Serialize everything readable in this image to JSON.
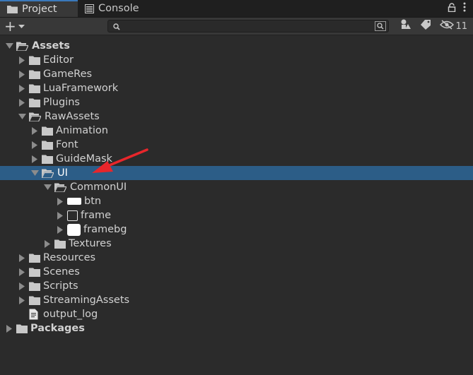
{
  "tabs": [
    {
      "label": "Project",
      "icon": "folder-icon",
      "active": true
    },
    {
      "label": "Console",
      "icon": "console-icon",
      "active": false
    }
  ],
  "toolbar": {
    "add_label": "+",
    "search_value": "",
    "hidden_count": "11"
  },
  "tree": [
    {
      "label": "Assets",
      "depth": 0,
      "expanded": true,
      "bold": true,
      "icon": "folder-open-icon"
    },
    {
      "label": "Editor",
      "depth": 1,
      "expanded": false,
      "icon": "folder-icon"
    },
    {
      "label": "GameRes",
      "depth": 1,
      "expanded": false,
      "icon": "folder-icon"
    },
    {
      "label": "LuaFramework",
      "depth": 1,
      "expanded": false,
      "icon": "folder-icon"
    },
    {
      "label": "Plugins",
      "depth": 1,
      "expanded": false,
      "icon": "folder-icon"
    },
    {
      "label": "RawAssets",
      "depth": 1,
      "expanded": true,
      "icon": "folder-open-icon"
    },
    {
      "label": "Animation",
      "depth": 2,
      "expanded": false,
      "icon": "folder-icon"
    },
    {
      "label": "Font",
      "depth": 2,
      "expanded": false,
      "icon": "folder-icon"
    },
    {
      "label": "GuideMask",
      "depth": 2,
      "expanded": false,
      "icon": "folder-icon"
    },
    {
      "label": "UI",
      "depth": 2,
      "expanded": true,
      "icon": "folder-open-icon",
      "selected": true
    },
    {
      "label": "CommonUI",
      "depth": 3,
      "expanded": true,
      "icon": "folder-open-icon"
    },
    {
      "label": "btn",
      "depth": 4,
      "expanded": false,
      "icon": "sprite-btn-icon"
    },
    {
      "label": "frame",
      "depth": 4,
      "expanded": false,
      "icon": "sprite-frame-icon"
    },
    {
      "label": "framebg",
      "depth": 4,
      "expanded": false,
      "icon": "sprite-framebg-icon"
    },
    {
      "label": "Textures",
      "depth": 3,
      "expanded": false,
      "icon": "folder-icon"
    },
    {
      "label": "Resources",
      "depth": 1,
      "expanded": false,
      "icon": "folder-icon"
    },
    {
      "label": "Scenes",
      "depth": 1,
      "expanded": false,
      "icon": "folder-icon"
    },
    {
      "label": "Scripts",
      "depth": 1,
      "expanded": false,
      "icon": "folder-icon"
    },
    {
      "label": "StreamingAssets",
      "depth": 1,
      "expanded": false,
      "icon": "folder-icon"
    },
    {
      "label": "output_log",
      "depth": 1,
      "leaf": true,
      "icon": "text-file-icon"
    },
    {
      "label": "Packages",
      "depth": 0,
      "expanded": false,
      "bold": true,
      "icon": "folder-icon"
    }
  ],
  "colors": {
    "selection": "#2c5d87",
    "annotation_arrow": "#e8262b"
  }
}
